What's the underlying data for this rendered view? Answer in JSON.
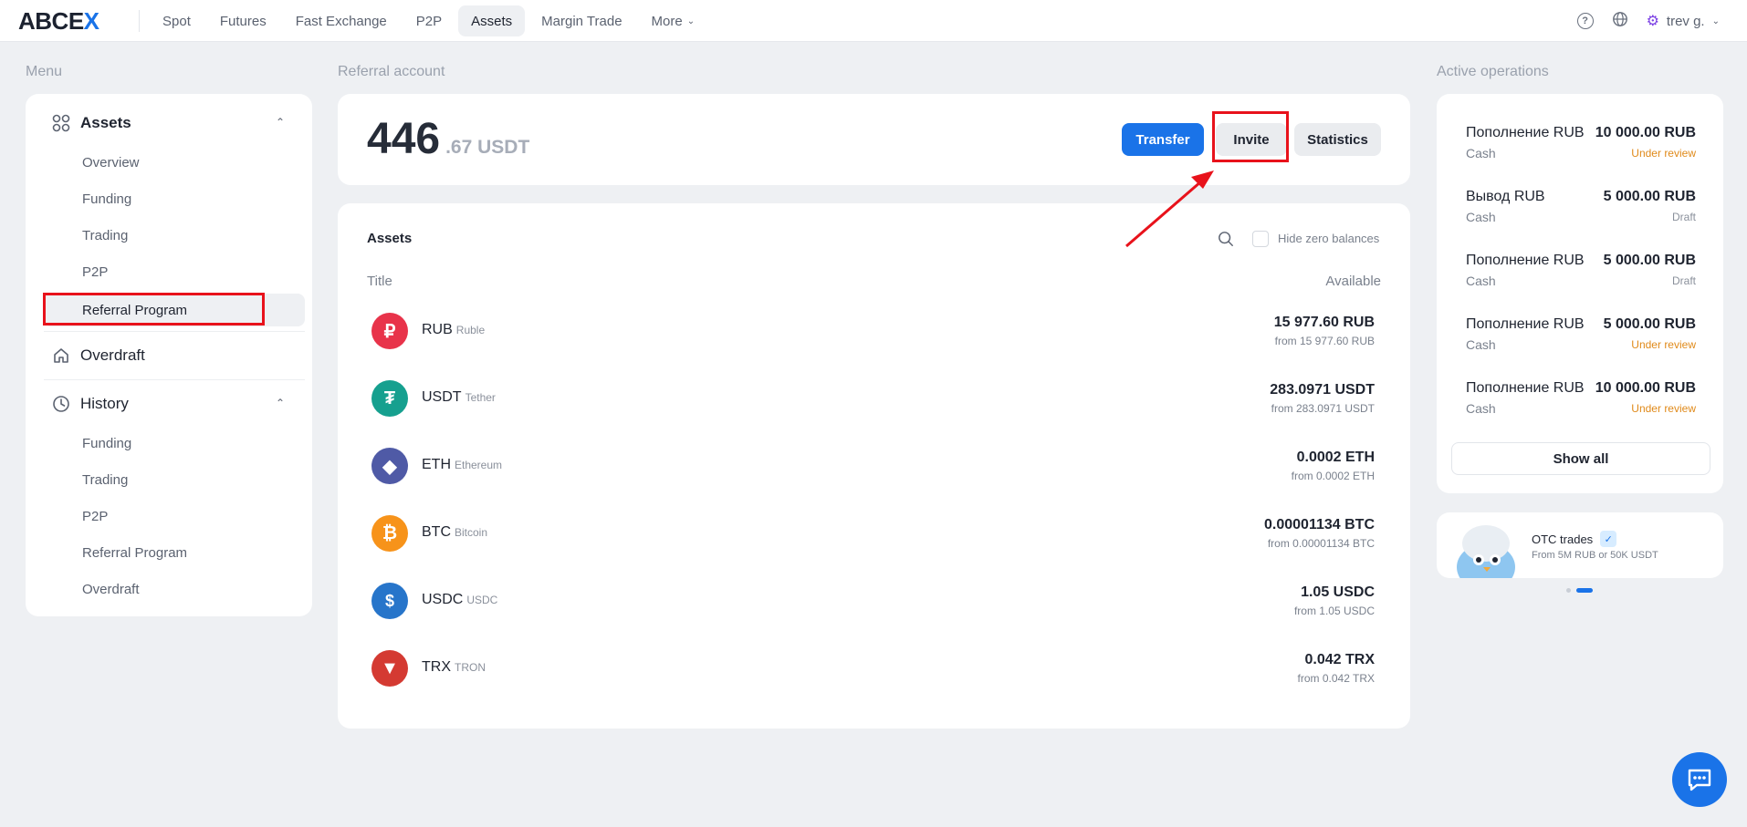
{
  "logo": {
    "part1": "ABCE",
    "part2": "X"
  },
  "nav": [
    "Spot",
    "Futures",
    "Fast Exchange",
    "P2P",
    "Assets",
    "Margin Trade",
    "More"
  ],
  "user": {
    "name": "trev g."
  },
  "labels": {
    "menu": "Menu",
    "referral_account": "Referral account",
    "active_operations": "Active operations"
  },
  "menu": {
    "assets": "Assets",
    "assets_items": [
      "Overview",
      "Funding",
      "Trading",
      "P2P",
      "Referral Program"
    ],
    "overdraft": "Overdraft",
    "history": "History",
    "history_items": [
      "Funding",
      "Trading",
      "P2P",
      "Referral Program",
      "Overdraft"
    ]
  },
  "referral": {
    "balance_int": "446",
    "balance_frac": ".67 USDT",
    "transfer": "Transfer",
    "invite": "Invite",
    "statistics": "Statistics"
  },
  "assets": {
    "title": "Assets",
    "hide_zero": "Hide zero balances",
    "col_title": "Title",
    "col_available": "Available",
    "rows": [
      {
        "symbol": "RUB",
        "name": "Ruble",
        "amount": "15 977.60 RUB",
        "from": "from 15 977.60 RUB",
        "color": "#e8334a"
      },
      {
        "symbol": "USDT",
        "name": "Tether",
        "amount": "283.0971 USDT",
        "from": "from 283.0971 USDT",
        "color": "#16a08f"
      },
      {
        "symbol": "ETH",
        "name": "Ethereum",
        "amount": "0.0002 ETH",
        "from": "from 0.0002 ETH",
        "color": "#4f5aa6"
      },
      {
        "symbol": "BTC",
        "name": "Bitcoin",
        "amount": "0.00001134 BTC",
        "from": "from 0.00001134 BTC",
        "color": "#f7931a"
      },
      {
        "symbol": "USDC",
        "name": "USDC",
        "amount": "1.05 USDC",
        "from": "from 1.05 USDC",
        "color": "#2775ca"
      },
      {
        "symbol": "TRX",
        "name": "TRON",
        "amount": "0.042 TRX",
        "from": "from 0.042 TRX",
        "color": "#d43a32"
      }
    ]
  },
  "operations": [
    {
      "title": "Пополнение RUB",
      "sub": "Cash",
      "amount": "10 000.00 RUB",
      "status": "Under review",
      "kind": "review"
    },
    {
      "title": "Вывод RUB",
      "sub": "Cash",
      "amount": "5 000.00 RUB",
      "status": "Draft",
      "kind": "draft"
    },
    {
      "title": "Пополнение RUB",
      "sub": "Cash",
      "amount": "5 000.00 RUB",
      "status": "Draft",
      "kind": "draft"
    },
    {
      "title": "Пополнение RUB",
      "sub": "Cash",
      "amount": "5 000.00 RUB",
      "status": "Under review",
      "kind": "review"
    },
    {
      "title": "Пополнение RUB",
      "sub": "Cash",
      "amount": "10 000.00 RUB",
      "status": "Under review",
      "kind": "review"
    }
  ],
  "show_all": "Show all",
  "otc": {
    "title": "OTC trades",
    "sub": "From 5M RUB or 50K USDT"
  },
  "colors": {
    "accent": "#1a73e8",
    "highlight": "#e8121b",
    "review": "#e08a1a"
  }
}
